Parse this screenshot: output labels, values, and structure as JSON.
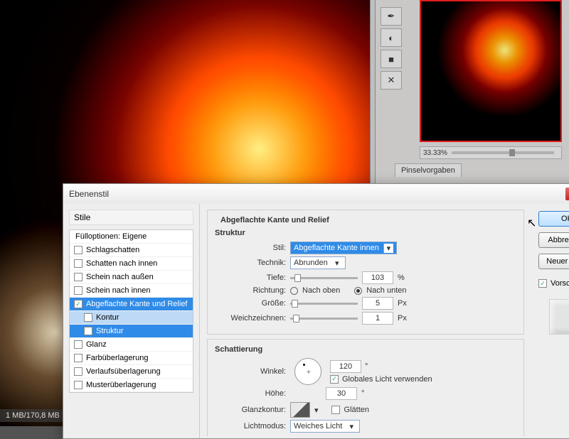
{
  "status": "1 MB/170,8 MB",
  "zoom": "33.33%",
  "panel_tab": "Pinselvorgaben",
  "dialog": {
    "title": "Ebenenstil",
    "close": "x",
    "styles_header": "Stile",
    "styles": {
      "blend_options": "Fülloptionen: Eigene",
      "drop_shadow": "Schlagschatten",
      "inner_shadow": "Schatten nach innen",
      "outer_glow": "Schein nach außen",
      "inner_glow": "Schein nach innen",
      "bevel": "Abgeflachte Kante und Relief",
      "contour": "Kontur",
      "texture": "Struktur",
      "satin": "Glanz",
      "color_overlay": "Farbüberlagerung",
      "gradient_overlay": "Verlaufsüberlagerung",
      "pattern_overlay": "Musterüberlagerung"
    },
    "section_title": "Abgeflachte Kante und Relief",
    "struktur": {
      "header": "Struktur",
      "stil_label": "Stil:",
      "stil_value": "Abgeflachte Kante innen",
      "technik_label": "Technik:",
      "technik_value": "Abrunden",
      "tiefe_label": "Tiefe:",
      "tiefe_value": "103",
      "tiefe_unit": "%",
      "richtung_label": "Richtung:",
      "richtung_up": "Nach oben",
      "richtung_down": "Nach unten",
      "groesse_label": "Größe:",
      "groesse_value": "5",
      "groesse_unit": "Px",
      "weich_label": "Weichzeichnen:",
      "weich_value": "1",
      "weich_unit": "Px"
    },
    "schattierung": {
      "header": "Schattierung",
      "winkel_label": "Winkel:",
      "winkel_value": "120",
      "winkel_unit": "°",
      "global_label": "Globales Licht verwenden",
      "hoehe_label": "Höhe:",
      "hoehe_value": "30",
      "hoehe_unit": "°",
      "kontur_label": "Glanzkontur:",
      "glaetten_label": "Glätten",
      "lichtmodus_label": "Lichtmodus:",
      "lichtmodus_value": "Weiches Licht"
    },
    "buttons": {
      "ok": "OK",
      "cancel": "Abbrechen",
      "new_style": "Neuer Stil...",
      "preview": "Vorschau"
    }
  }
}
